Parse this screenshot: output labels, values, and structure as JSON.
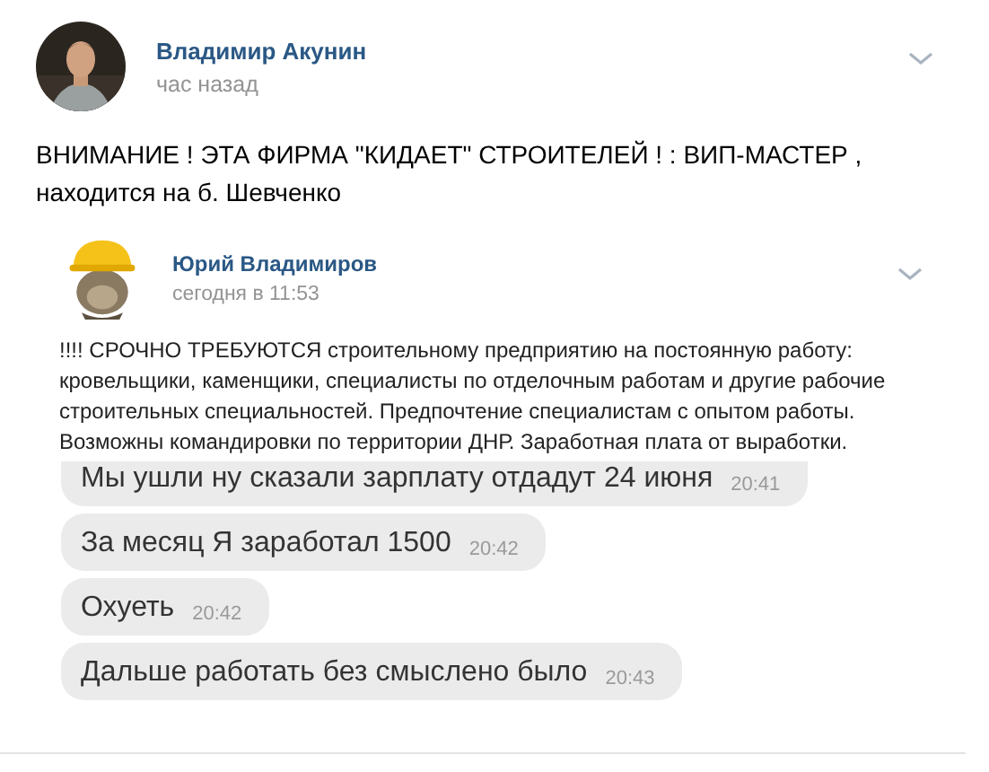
{
  "post": {
    "author": "Владимир Акунин",
    "time": "час назад",
    "text": "ВНИМАНИЕ ! ЭТА ФИРМА \"КИДАЕТ\" СТРОИТЕЛЕЙ ! : ВИП-МАСТЕР , находится на б. Шевченко",
    "repost": {
      "author": "Юрий Владимиров",
      "time": "сегодня в 11:53",
      "text": "!!!! СРОЧНО ТРЕБУЮТСЯ строительному предприятию на постоянную работу: кровельщики, каменщики, специалисты по отделочным работам и другие рабочие строительных специальностей. Предпочтение специалистам с опытом работы. Возможны командировки по территории ДНР. Заработная плата от выработки.",
      "chat_messages": [
        {
          "text": "Мы ушли ну сказали зарплату отдадут 24 июня",
          "time": "20:41"
        },
        {
          "text": "За месяц Я заработал 1500",
          "time": "20:42"
        },
        {
          "text": "Охуеть",
          "time": "20:42"
        },
        {
          "text": "Дальше работать без смыслено было",
          "time": "20:43"
        }
      ]
    }
  }
}
